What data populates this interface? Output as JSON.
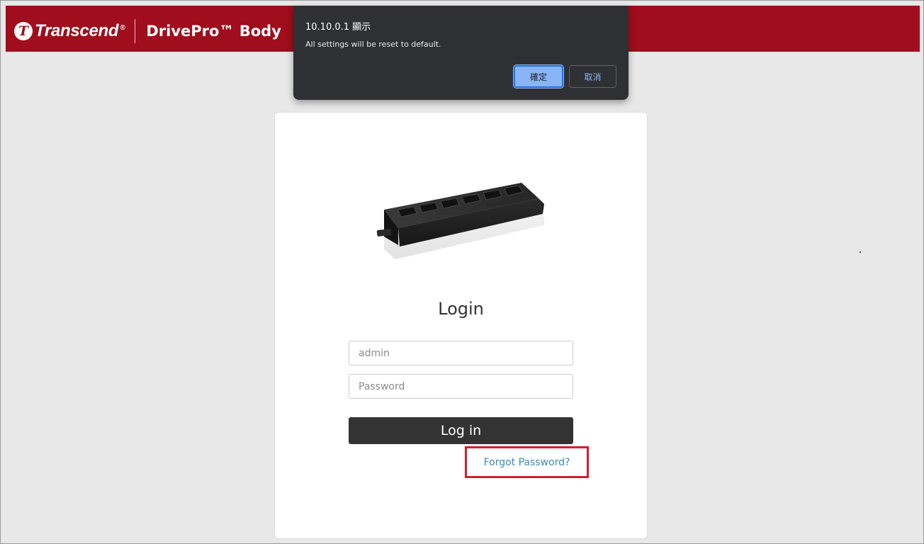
{
  "header": {
    "brand_mark": "T",
    "brand_name": "Transcend",
    "brand_reg": "®",
    "product_name": "DrivePro™ Body",
    "background_color": "#a00d1c"
  },
  "dialog": {
    "title": "10.10.0.1 顯示",
    "message": "All settings will be reset to default.",
    "ok_label": "確定",
    "cancel_label": "取消"
  },
  "login": {
    "image_alt": "docking station",
    "title": "Login",
    "username_value": "",
    "username_placeholder": "admin",
    "password_value": "",
    "password_placeholder": "Password",
    "login_button_label": "Log in",
    "forgot_password_label": "Forgot Password?"
  },
  "colors": {
    "accent_red": "#a00d1c",
    "highlight_red": "#d0202e",
    "link_blue": "#3b8ab3",
    "button_dark": "#333333",
    "dialog_bg": "#2f3033",
    "dialog_ok": "#8ab4f8"
  }
}
